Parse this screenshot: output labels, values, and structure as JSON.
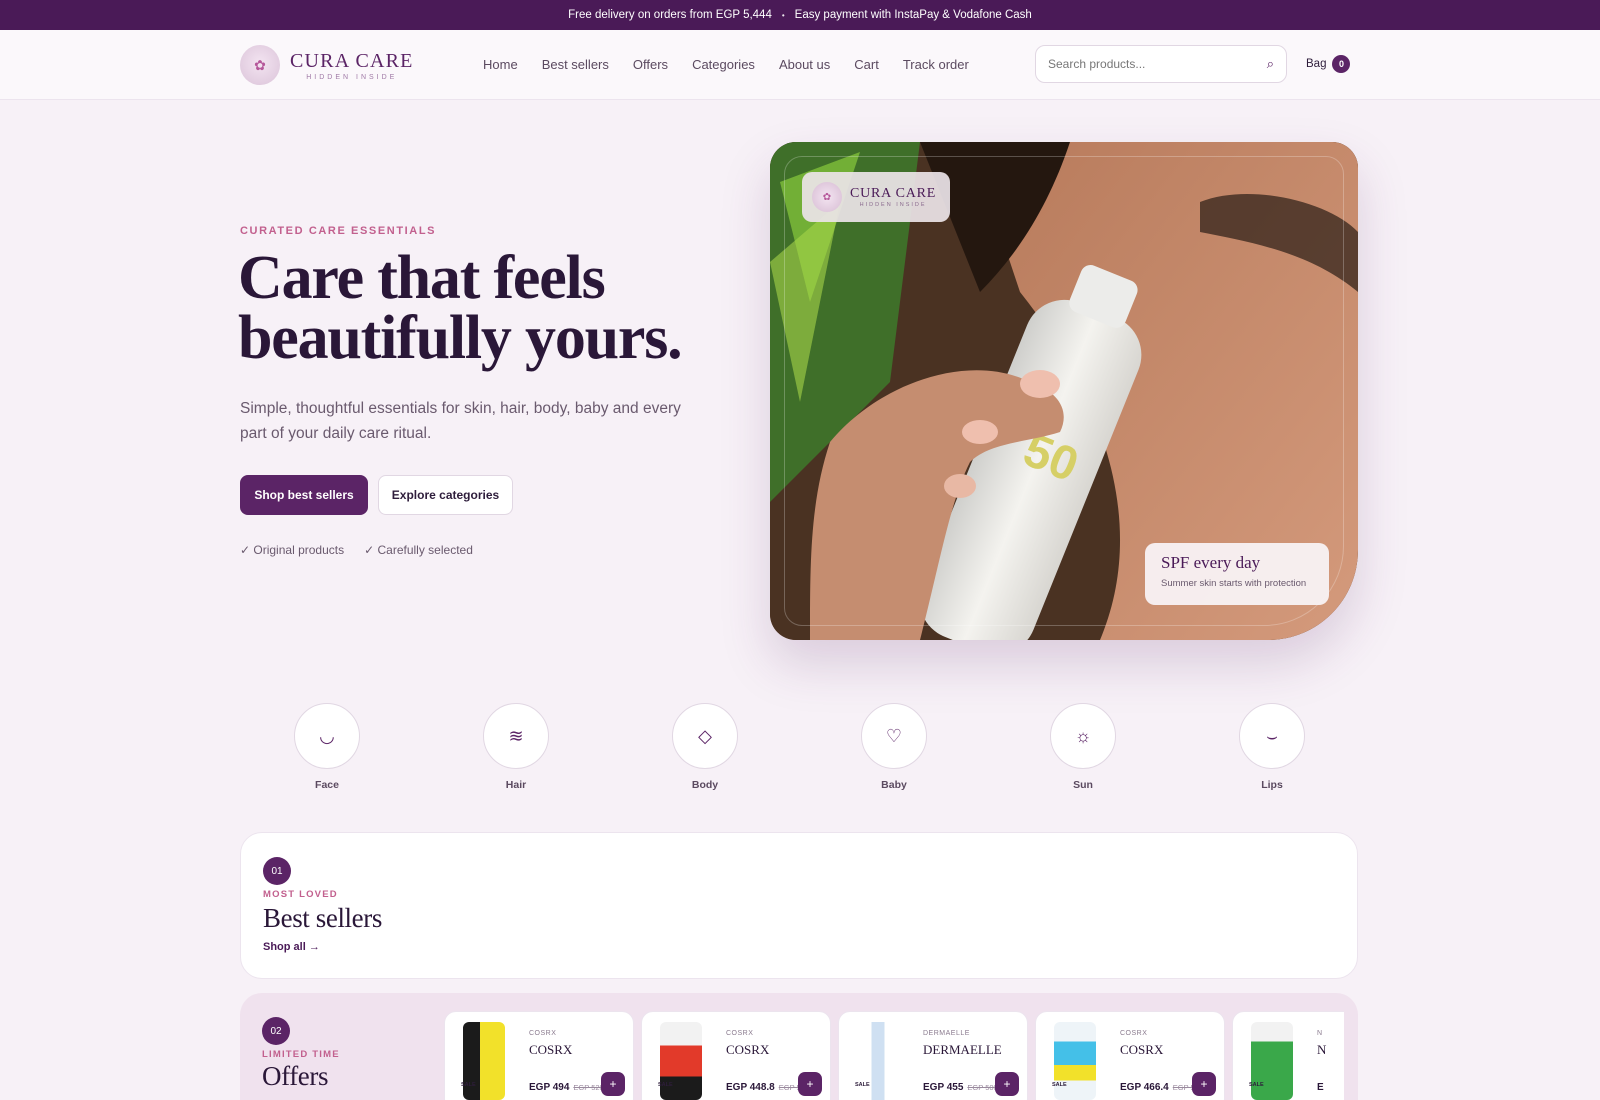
{
  "announcement": {
    "delivery": "Free delivery on orders from EGP 5,444",
    "separator": "•",
    "payment": "Easy payment with InstaPay & Vodafone Cash"
  },
  "brand": {
    "name": "CURA CARE",
    "tagline": "HIDDEN INSIDE",
    "logo_icon": "lotus-icon"
  },
  "nav": {
    "items": [
      "Home",
      "Best sellers",
      "Offers",
      "Categories",
      "About us",
      "Cart",
      "Track order"
    ]
  },
  "search": {
    "placeholder": "Search products...",
    "icon": "search-icon"
  },
  "bag": {
    "label": "Bag",
    "count": "0"
  },
  "hero": {
    "eyebrow": "CURATED CARE ESSENTIALS",
    "headline": "Care that feels beautifully yours.",
    "subcopy": "Simple, thoughtful essentials for skin, hair, body, baby and every part of your daily care ritual.",
    "primary_cta": "Shop best sellers",
    "secondary_cta": "Explore categories",
    "trust": [
      "✓ Original products",
      "✓ Carefully selected"
    ],
    "image_badge": {
      "name": "CURA CARE",
      "tagline": "HIDDEN INSIDE"
    },
    "spf_card": {
      "title": "SPF every day",
      "subtitle": "Summer skin starts with protection"
    }
  },
  "categories": [
    {
      "label": "Face",
      "icon": "smile-curve-icon",
      "glyph": "◡"
    },
    {
      "label": "Hair",
      "icon": "waves-icon",
      "glyph": "≋"
    },
    {
      "label": "Body",
      "icon": "diamond-icon",
      "glyph": "◇"
    },
    {
      "label": "Baby",
      "icon": "heart-icon",
      "glyph": "♡"
    },
    {
      "label": "Sun",
      "icon": "sun-icon",
      "glyph": "☼"
    },
    {
      "label": "Lips",
      "icon": "lips-icon",
      "glyph": "⌣"
    }
  ],
  "best_sellers": {
    "number": "01",
    "eyebrow": "MOST LOVED",
    "title": "Best sellers",
    "link": "Shop all →"
  },
  "offers": {
    "number": "02",
    "eyebrow": "LIMITED TIME",
    "title": "Offers",
    "products": [
      {
        "brand_small": "COSRX",
        "brand": "COSRX",
        "price": "EGP 494",
        "old_price": "EGP 520",
        "sale": "SALE",
        "add": "+",
        "color": "#f2e12a"
      },
      {
        "brand_small": "COSRX",
        "brand": "COSRX",
        "price": "EGP 448.8",
        "old_price": "EGP 510",
        "sale": "SALE",
        "add": "+",
        "color": "#e23a2a"
      },
      {
        "brand_small": "DERMAELLE",
        "brand": "DERMAELLE",
        "price": "EGP 455",
        "old_price": "EGP 500",
        "sale": "SALE",
        "add": "+",
        "color": "#cfe0f2"
      },
      {
        "brand_small": "COSRX",
        "brand": "COSRX",
        "price": "EGP 466.4",
        "old_price": "EGP 530",
        "sale": "SALE",
        "add": "+",
        "color": "#44c0e8"
      },
      {
        "brand_small": "N",
        "brand": "N",
        "price": "E",
        "old_price": "",
        "sale": "SALE",
        "add": "+",
        "color": "#3aa84a"
      }
    ]
  },
  "colors": {
    "primary": "#5b2466",
    "accent": "#c2608e",
    "announce_bg": "#4a1a57",
    "page_bg": "#f7f1f7"
  }
}
